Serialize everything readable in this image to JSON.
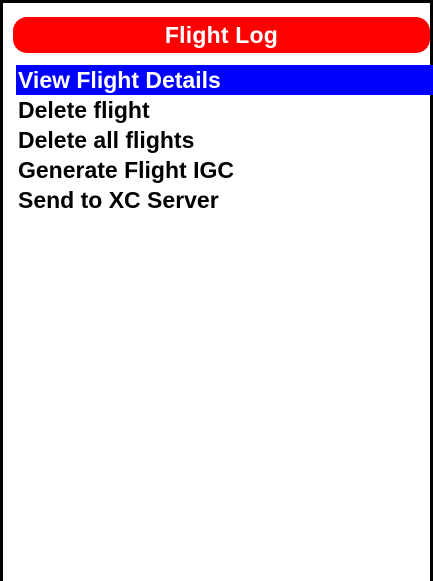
{
  "header": {
    "title": "Flight Log"
  },
  "menu": {
    "selected_index": 0,
    "items": [
      {
        "label": "View Flight Details"
      },
      {
        "label": "Delete flight"
      },
      {
        "label": "Delete all flights"
      },
      {
        "label": "Generate Flight IGC"
      },
      {
        "label": "Send to XC Server"
      }
    ]
  },
  "colors": {
    "title_bar": "#ff0000",
    "title_text": "#ffffff",
    "selection": "#0000ff",
    "background": "#ffffff",
    "text": "#000000"
  }
}
